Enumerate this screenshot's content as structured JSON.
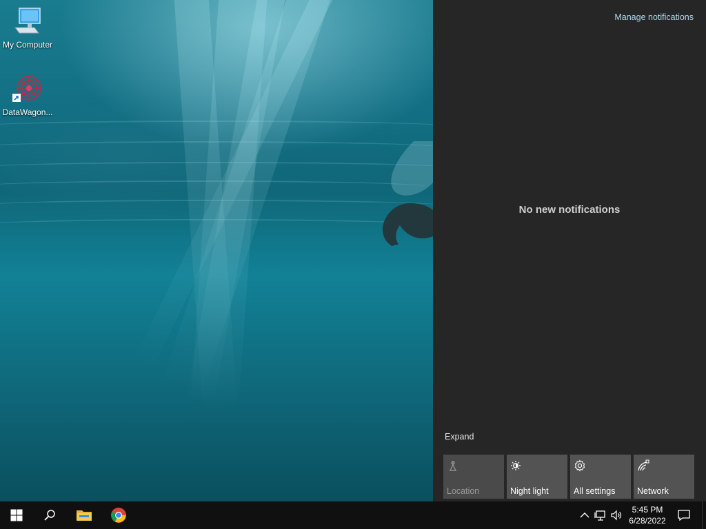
{
  "desktop": {
    "icons": [
      {
        "label": "My Computer",
        "icon": "computer-icon"
      },
      {
        "label": "DataWagon...",
        "icon": "datawagon-icon"
      }
    ]
  },
  "action_center": {
    "manage_notifications": "Manage notifications",
    "empty_message": "No new notifications",
    "expand_label": "Expand",
    "quick_actions": [
      {
        "label": "Location",
        "icon": "location-icon",
        "enabled": false
      },
      {
        "label": "Night light",
        "icon": "night-light-icon",
        "enabled": true
      },
      {
        "label": "All settings",
        "icon": "settings-gear-icon",
        "enabled": true
      },
      {
        "label": "Network",
        "icon": "network-icon",
        "enabled": true
      }
    ]
  },
  "taskbar": {
    "pinned": [
      {
        "name": "windows-start-icon"
      },
      {
        "name": "search-icon"
      },
      {
        "name": "file-explorer-icon"
      },
      {
        "name": "chrome-icon"
      }
    ],
    "tray": {
      "icons": [
        "chevron-up-icon",
        "network-icon",
        "volume-icon"
      ],
      "time": "5:45 PM",
      "date": "6/28/2022"
    }
  },
  "colors": {
    "action_center_bg": "#262626",
    "tile_bg": "#535353",
    "link_color": "#a9d8ea",
    "taskbar_bg": "#101010"
  }
}
